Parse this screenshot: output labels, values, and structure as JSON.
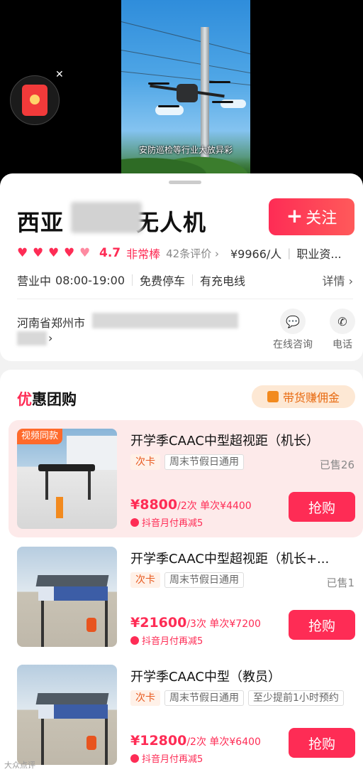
{
  "video": {
    "subtitle": "安防巡检等行业大放异彩"
  },
  "shop": {
    "name_prefix": "西亚",
    "name_suffix": "无人机",
    "follow_label": "关注",
    "rating": "4.7",
    "rating_label": "非常棒",
    "reviews": "42条评价 ›",
    "price_per_person": "¥9966/人",
    "category": "职业资...",
    "status": "营业中",
    "hours": "08:00-19:00",
    "feature1": "免费停车",
    "feature2": "有充电线",
    "details_label": "详情 ›",
    "address_prefix": "河南省郑州市",
    "address_arrow": "›",
    "consult_label": "在线咨询",
    "phone_label": "电话"
  },
  "deals_section": {
    "title_first": "优",
    "title_rest": "惠团购",
    "commission_label": "带货赚佣金"
  },
  "deals": [
    {
      "video_tag": "视频同款",
      "title": "开学季CAAC中型超视距（机长）",
      "tags": [
        "次卡",
        "周末节假日通用"
      ],
      "sold": "已售26",
      "price": "¥8800",
      "price_unit": "/2次 单次¥4400",
      "discount": "抖音月付再减5",
      "buy_label": "抢购"
    },
    {
      "title": "开学季CAAC中型超视距（机长+...",
      "tags": [
        "次卡",
        "周末节假日通用"
      ],
      "sold": "已售1",
      "price": "¥21600",
      "price_unit": "/3次 单次¥7200",
      "discount": "抖音月付再减5",
      "buy_label": "抢购"
    },
    {
      "title": "开学季CAAC中型（教员）",
      "tags": [
        "次卡",
        "周末节假日通用",
        "至少提前1小时预约"
      ],
      "price": "¥12800",
      "price_unit": "/2次 单次¥6400",
      "discount": "抖音月付再减5",
      "buy_label": "抢购"
    }
  ],
  "watermark": "大众点评",
  "colors": {
    "accent": "#fe2c55",
    "orange": "#e8591e"
  }
}
